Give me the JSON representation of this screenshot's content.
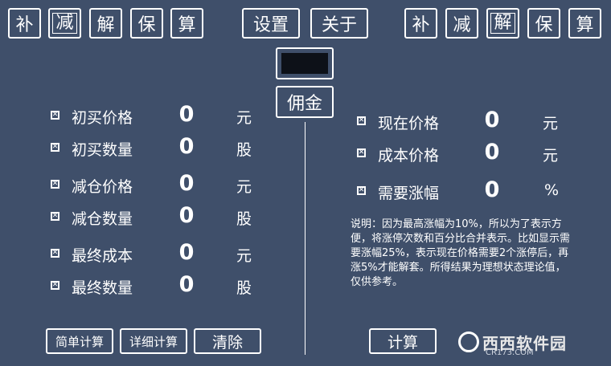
{
  "left_tabs": [
    {
      "label": "补",
      "active": false
    },
    {
      "label": "减",
      "active": true
    },
    {
      "label": "解",
      "active": false
    },
    {
      "label": "保",
      "active": false
    },
    {
      "label": "算",
      "active": false
    }
  ],
  "right_tabs": [
    {
      "label": "补",
      "active": false
    },
    {
      "label": "减",
      "active": false
    },
    {
      "label": "解",
      "active": true
    },
    {
      "label": "保",
      "active": false
    },
    {
      "label": "算",
      "active": false
    }
  ],
  "center": {
    "settings_label": "设置",
    "about_label": "关于",
    "commission_label": "佣金"
  },
  "left_rows": [
    {
      "label": "初买价格",
      "value": "0",
      "unit": "元",
      "checked": true
    },
    {
      "label": "初买数量",
      "value": "0",
      "unit": "股",
      "checked": true
    },
    {
      "label": "减仓价格",
      "value": "0",
      "unit": "元",
      "checked": true
    },
    {
      "label": "减仓数量",
      "value": "0",
      "unit": "股",
      "checked": true
    },
    {
      "label": "最终成本",
      "value": "0",
      "unit": "元",
      "checked": true
    },
    {
      "label": "最终数量",
      "value": "0",
      "unit": "股",
      "checked": true
    }
  ],
  "right_rows": [
    {
      "label": "现在价格",
      "value": "0",
      "unit": "元",
      "checked": true
    },
    {
      "label": "成本价格",
      "value": "0",
      "unit": "元",
      "checked": true
    },
    {
      "label": "需要涨幅",
      "value": "0",
      "unit": "%",
      "checked": true
    }
  ],
  "note": "说明：因为最高涨幅为10%，所以为了表示方便，将涨停次数和百分比合并表示。比如显示需要涨幅25%，表示现在价格需要2个涨停后，再涨5%才能解套。所得结果为理想状态理论值，仅供参考。",
  "buttons": {
    "simple_calc": "简单计算",
    "detail_calc": "详细计算",
    "clear": "清除",
    "calc": "计算"
  },
  "watermark": {
    "brand": "西西软件园",
    "site": "CR173.COM"
  },
  "colors": {
    "background": "#3f4f6a",
    "foreground": "#ffffff",
    "display": "#0d1118"
  },
  "checkbox_icon": "x-checkbox-icon"
}
